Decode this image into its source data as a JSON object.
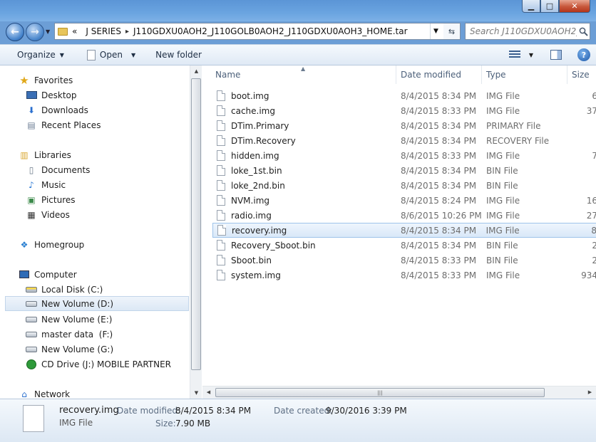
{
  "window": {
    "controls": {
      "minimize": "▁",
      "maximize": "□",
      "close": "✕"
    }
  },
  "nav": {
    "back_icon": "←",
    "forward_icon": "→"
  },
  "address": {
    "overflow": "«",
    "crumbs": [
      "J SERIES",
      "J110GDXU0AOH2_J110GOLB0AOH2_J110GDXU0AOH3_HOME.tar"
    ],
    "search_placeholder": "Search J110GDXU0AOH2_..."
  },
  "toolbar": {
    "organize": "Organize",
    "open": "Open",
    "new_folder": "New folder",
    "help": "?"
  },
  "sidebar": {
    "favorites": "Favorites",
    "desktop": "Desktop",
    "downloads": "Downloads",
    "recent_places": "Recent Places",
    "libraries": "Libraries",
    "documents": "Documents",
    "music": "Music",
    "pictures": "Pictures",
    "videos": "Videos",
    "homegroup": "Homegroup",
    "computer": "Computer",
    "local_disk_c": "Local Disk (C:)",
    "new_volume_d": "New Volume (D:)",
    "new_volume_e": "New Volume (E:)",
    "master_data_f": "master data  (F:)",
    "new_volume_g": "New Volume (G:)",
    "cd_drive_j": "CD Drive (J:) MOBILE PARTNER",
    "network": "Network"
  },
  "columns": {
    "name": "Name",
    "date": "Date modified",
    "type": "Type",
    "size": "Size"
  },
  "files": [
    {
      "name": "boot.img",
      "date": "8/4/2015 8:34 PM",
      "type": "IMG File",
      "size": "6"
    },
    {
      "name": "cache.img",
      "date": "8/4/2015 8:33 PM",
      "type": "IMG File",
      "size": "37"
    },
    {
      "name": "DTim.Primary",
      "date": "8/4/2015 8:34 PM",
      "type": "PRIMARY File",
      "size": ""
    },
    {
      "name": "DTim.Recovery",
      "date": "8/4/2015 8:34 PM",
      "type": "RECOVERY File",
      "size": ""
    },
    {
      "name": "hidden.img",
      "date": "8/4/2015 8:33 PM",
      "type": "IMG File",
      "size": "7"
    },
    {
      "name": "loke_1st.bin",
      "date": "8/4/2015 8:34 PM",
      "type": "BIN File",
      "size": ""
    },
    {
      "name": "loke_2nd.bin",
      "date": "8/4/2015 8:34 PM",
      "type": "BIN File",
      "size": ""
    },
    {
      "name": "NVM.img",
      "date": "8/4/2015 8:24 PM",
      "type": "IMG File",
      "size": "16"
    },
    {
      "name": "radio.img",
      "date": "8/6/2015 10:26 PM",
      "type": "IMG File",
      "size": "27"
    },
    {
      "name": "recovery.img",
      "date": "8/4/2015 8:34 PM",
      "type": "IMG File",
      "size": "8"
    },
    {
      "name": "Recovery_Sboot.bin",
      "date": "8/4/2015 8:34 PM",
      "type": "BIN File",
      "size": "2"
    },
    {
      "name": "Sboot.bin",
      "date": "8/4/2015 8:33 PM",
      "type": "BIN File",
      "size": "2"
    },
    {
      "name": "system.img",
      "date": "8/4/2015 8:33 PM",
      "type": "IMG File",
      "size": "934"
    }
  ],
  "selected_file": "recovery.img",
  "details": {
    "name": "recovery.img",
    "type": "IMG File",
    "date_modified_label": "Date modified:",
    "date_modified": "8/4/2015 8:34 PM",
    "size_label": "Size:",
    "size": "7.90 MB",
    "date_created_label": "Date created:",
    "date_created": "9/30/2016 3:39 PM"
  }
}
